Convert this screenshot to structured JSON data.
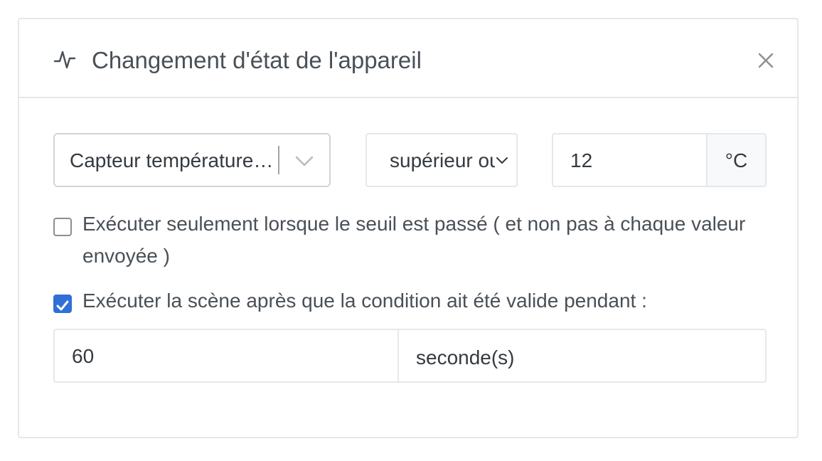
{
  "header": {
    "title": "Changement d'état de l'appareil",
    "icon": "activity-icon",
    "close_icon": "close-icon"
  },
  "condition": {
    "device": "Capteur température salon",
    "operator": "supérieur ou égal à",
    "value": "12",
    "unit": "°C"
  },
  "options": {
    "threshold_only": {
      "checked": false,
      "label": "Exécuter seulement lorsque le seuil est passé ( et non pas à chaque valeur envoyée )"
    },
    "delay": {
      "checked": true,
      "label": "Exécuter la scène après que la condition ait été valide pendant :"
    }
  },
  "delay": {
    "value": "60",
    "unit": "seconde(s)"
  },
  "colors": {
    "accent": "#2f6fd7",
    "border": "#e5e7ea",
    "text": "#495057"
  }
}
